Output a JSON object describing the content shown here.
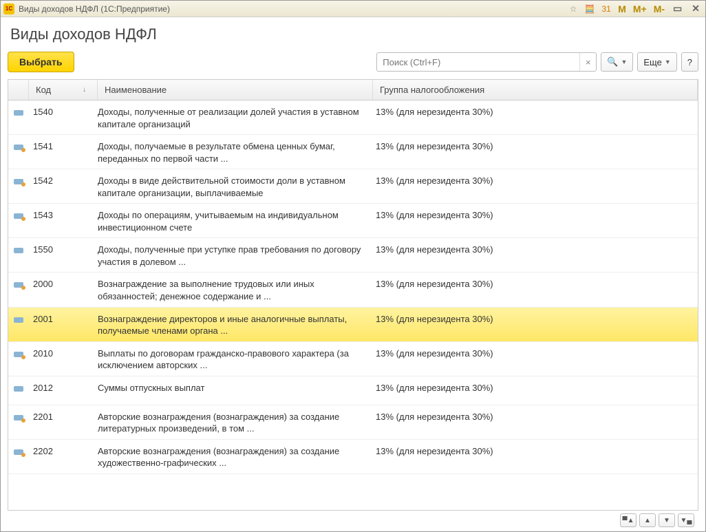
{
  "titlebar": {
    "title": "Виды доходов НДФЛ (1С:Предприятие)",
    "logo": "1С"
  },
  "page": {
    "title": "Виды доходов НДФЛ"
  },
  "toolbar": {
    "select_label": "Выбрать",
    "more_label": "Еще",
    "help_label": "?"
  },
  "search": {
    "placeholder": "Поиск (Ctrl+F)"
  },
  "table": {
    "headers": {
      "code": "Код",
      "name": "Наименование",
      "group": "Группа налогообложения"
    },
    "rows": [
      {
        "icon": "std",
        "code": "1540",
        "name": "Доходы, полученные от реализации долей участия в уставном капитале организаций",
        "group": "13% (для нерезидента 30%)",
        "selected": false
      },
      {
        "icon": "alt",
        "code": "1541",
        "name": "Доходы, получаемые в результате обмена ценных бумаг, переданных по первой части ...",
        "group": "13% (для нерезидента 30%)",
        "selected": false
      },
      {
        "icon": "alt",
        "code": "1542",
        "name": "Доходы в виде действительной стоимости доли в уставном капитале организации, выплачиваемые",
        "group": "13% (для нерезидента 30%)",
        "selected": false
      },
      {
        "icon": "alt",
        "code": "1543",
        "name": "Доходы по операциям, учитываемым на индивидуальном инвестиционном счете",
        "group": "13% (для нерезидента 30%)",
        "selected": false
      },
      {
        "icon": "std",
        "code": "1550",
        "name": "Доходы, полученные при уступке прав требования по договору участия в долевом ...",
        "group": "13% (для нерезидента 30%)",
        "selected": false
      },
      {
        "icon": "alt",
        "code": "2000",
        "name": "Вознаграждение за выполнение трудовых или иных обязанностей; денежное содержание и ...",
        "group": "13% (для нерезидента 30%)",
        "selected": false
      },
      {
        "icon": "std",
        "code": "2001",
        "name": "Вознаграждение директоров и иные аналогичные выплаты, получаемые членами органа ...",
        "group": "13% (для нерезидента 30%)",
        "selected": true
      },
      {
        "icon": "alt",
        "code": "2010",
        "name": "Выплаты по договорам гражданско-правового характера (за исключением авторских ...",
        "group": "13% (для нерезидента 30%)",
        "selected": false
      },
      {
        "icon": "std",
        "code": "2012",
        "name": "Суммы отпускных выплат",
        "group": "13% (для нерезидента 30%)",
        "selected": false
      },
      {
        "icon": "alt",
        "code": "2201",
        "name": "Авторские вознаграждения (вознаграждения) за создание литературных произведений, в том ...",
        "group": "13% (для нерезидента 30%)",
        "selected": false
      },
      {
        "icon": "alt",
        "code": "2202",
        "name": "Авторские вознаграждения (вознаграждения) за создание художественно-графических ...",
        "group": "13% (для нерезидента 30%)",
        "selected": false
      }
    ]
  }
}
